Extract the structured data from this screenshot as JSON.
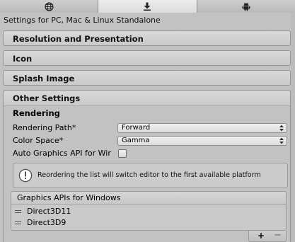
{
  "tabs": [
    {
      "icon": "globe-icon",
      "active": false
    },
    {
      "icon": "download-icon",
      "active": true
    },
    {
      "icon": "android-icon",
      "active": false
    }
  ],
  "settings_for": "Settings for PC, Mac & Linux Standalone",
  "sections": {
    "resolution": "Resolution and Presentation",
    "icon": "Icon",
    "splash": "Splash Image",
    "other": "Other Settings"
  },
  "rendering": {
    "title": "Rendering",
    "rendering_path_label": "Rendering Path*",
    "rendering_path_value": "Forward",
    "color_space_label": "Color Space*",
    "color_space_value": "Gamma",
    "auto_graphics_label": "Auto Graphics API for Wir",
    "auto_graphics_checked": false
  },
  "help": {
    "message": "Reordering the list will switch editor to the first available platform"
  },
  "graphics_list": {
    "title": "Graphics APIs for Windows",
    "items": [
      "Direct3D11",
      "Direct3D9"
    ],
    "add_label": "+",
    "remove_label": "−"
  }
}
